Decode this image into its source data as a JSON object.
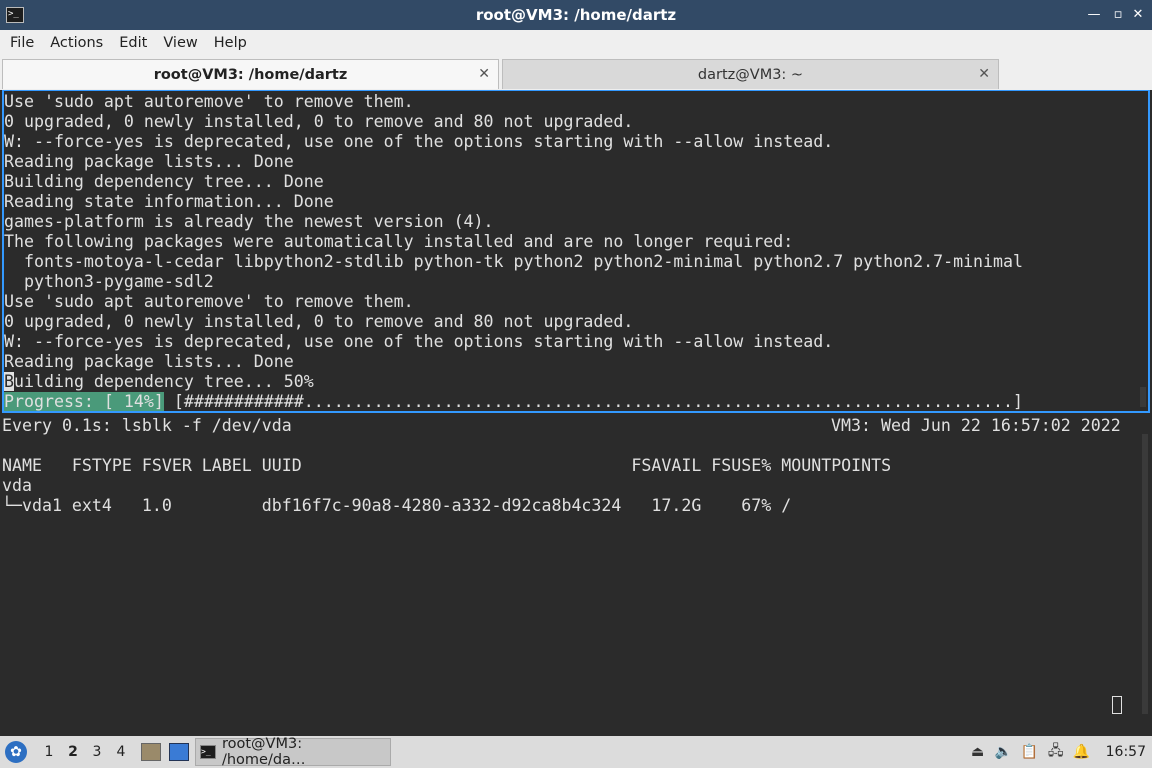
{
  "window": {
    "title": "root@VM3: /home/dartz",
    "controls": {
      "minimize": "—",
      "restore": "▫",
      "close": "✕"
    },
    "app_icon": ">_"
  },
  "menu": [
    "File",
    "Actions",
    "Edit",
    "View",
    "Help"
  ],
  "tabs": [
    {
      "label": "root@VM3: /home/dartz",
      "active": true,
      "close": "✕"
    },
    {
      "label": "dartz@VM3: ~",
      "active": false,
      "close": "✕"
    }
  ],
  "top_pane": {
    "lines": [
      "Use 'sudo apt autoremove' to remove them.",
      "0 upgraded, 0 newly installed, 0 to remove and 80 not upgraded.",
      "W: --force-yes is deprecated, use one of the options starting with --allow instead.",
      "Reading package lists... Done",
      "Building dependency tree... Done",
      "Reading state information... Done",
      "games-platform is already the newest version (4).",
      "The following packages were automatically installed and are no longer required:",
      "  fonts-motoya-l-cedar libpython2-stdlib python-tk python2 python2-minimal python2.7 python2.7-minimal",
      "  python3-pygame-sdl2",
      "Use 'sudo apt autoremove' to remove them.",
      "0 upgraded, 0 newly installed, 0 to remove and 80 not upgraded.",
      "W: --force-yes is deprecated, use one of the options starting with --allow instead.",
      "Reading package lists... Done"
    ],
    "cursor_line_char": "B",
    "cursor_line_rest": "uilding dependency tree... 50%",
    "progress_label": "Progress: [ 14%]",
    "progress_bar": " [############.......................................................................]"
  },
  "bottom_pane": {
    "watch_header": "Every 0.1s: lsblk -f /dev/vda",
    "watch_host_time": "VM3: Wed Jun 22 16:57:02 2022",
    "table_header": "NAME   FSTYPE FSVER LABEL UUID                                 FSAVAIL FSUSE% MOUNTPOINTS",
    "rows": [
      "vda",
      "└─vda1 ext4   1.0         dbf16f7c-90a8-4280-a332-d92ca8b4c324   17.2G    67% /"
    ]
  },
  "taskbar": {
    "desktops": [
      "1",
      "2",
      "3",
      "4"
    ],
    "current_desktop": "2",
    "task_label": "root@VM3: /home/da…",
    "clock": "16:57",
    "colors": {
      "accent": "#3399ff",
      "titlebar": "#324a66",
      "progress": "#4a9a7a"
    }
  }
}
